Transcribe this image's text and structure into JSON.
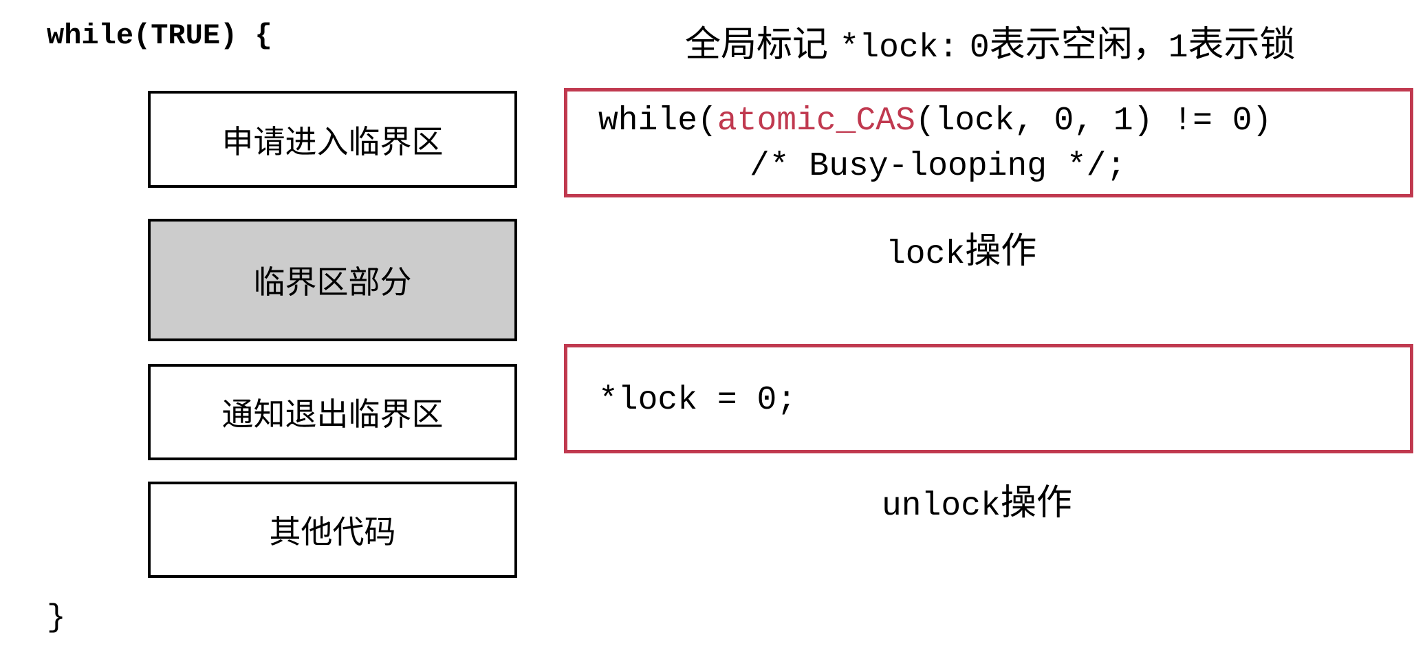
{
  "left": {
    "while_open": "while(TRUE) {",
    "brace_close": "}",
    "steps": [
      {
        "label": "申请进入临界区"
      },
      {
        "label": "临界区部分"
      },
      {
        "label": "通知退出临界区"
      },
      {
        "label": "其他代码"
      }
    ]
  },
  "right": {
    "title": {
      "prefix": "全局标记",
      "code": "*lock:",
      "zero": "0",
      "zero_text": "表示空闲，",
      "one": "1",
      "one_text": "表示锁"
    },
    "lock_code": {
      "line1_pre": "while(",
      "line1_func": "atomic_CAS",
      "line1_post": "(lock, 0, 1) != 0)",
      "line2": "/* Busy-looping */;"
    },
    "lock_caption": {
      "code": "lock",
      "text": "操作"
    },
    "unlock_code": {
      "line": "*lock = 0;"
    },
    "unlock_caption": {
      "code": "unlock",
      "text": "操作"
    }
  },
  "colors": {
    "accent": "#c0394f",
    "critical_fill": "#cccccc",
    "border": "#000000"
  }
}
